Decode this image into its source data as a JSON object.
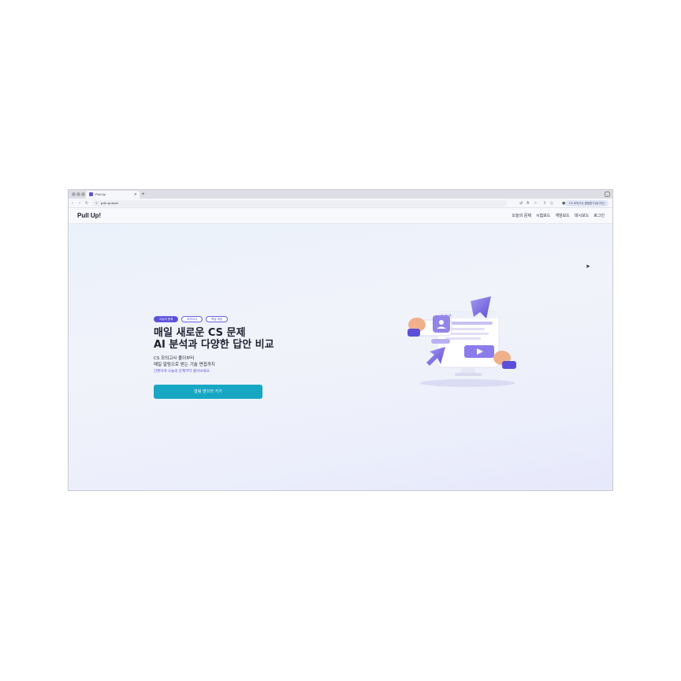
{
  "browser": {
    "tab_title": "Pull Up",
    "tab_close": "×",
    "new_tab": "+",
    "tab_menu": "⌄",
    "url": "pull-up.store",
    "profile_label": "CS 모의고사 알림받기(로그인)",
    "nav_icons": [
      "back-icon",
      "forward-icon",
      "reload-icon"
    ],
    "toolbar_icons": [
      "translate-icon",
      "font-icon",
      "star-icon",
      "share-icon",
      "extensions-icon",
      "profile-icon"
    ]
  },
  "site": {
    "logo": "Pull Up!",
    "nav": [
      "오늘의 문제",
      "시험모드",
      "게임모드",
      "대시보드",
      "로그인"
    ]
  },
  "hero": {
    "tags": [
      "오늘의 문제",
      "모의고사",
      "학습 게임"
    ],
    "headline_1": "매일 새로운 CS 문제",
    "headline_2": "AI 분석과 다양한 답안 비교",
    "sub_1": "CS 모의고사 풀이부터",
    "sub_2": "매일 알림으로 받는 기술 면접까지",
    "hint": "간편하게 오늘의 문제부터 풀어보세요.",
    "cta_label": "알림 받으러 가기"
  },
  "colors": {
    "accent": "#5b4fd9",
    "cta": "#17a7c2",
    "page_bg": "#eef1fa"
  }
}
